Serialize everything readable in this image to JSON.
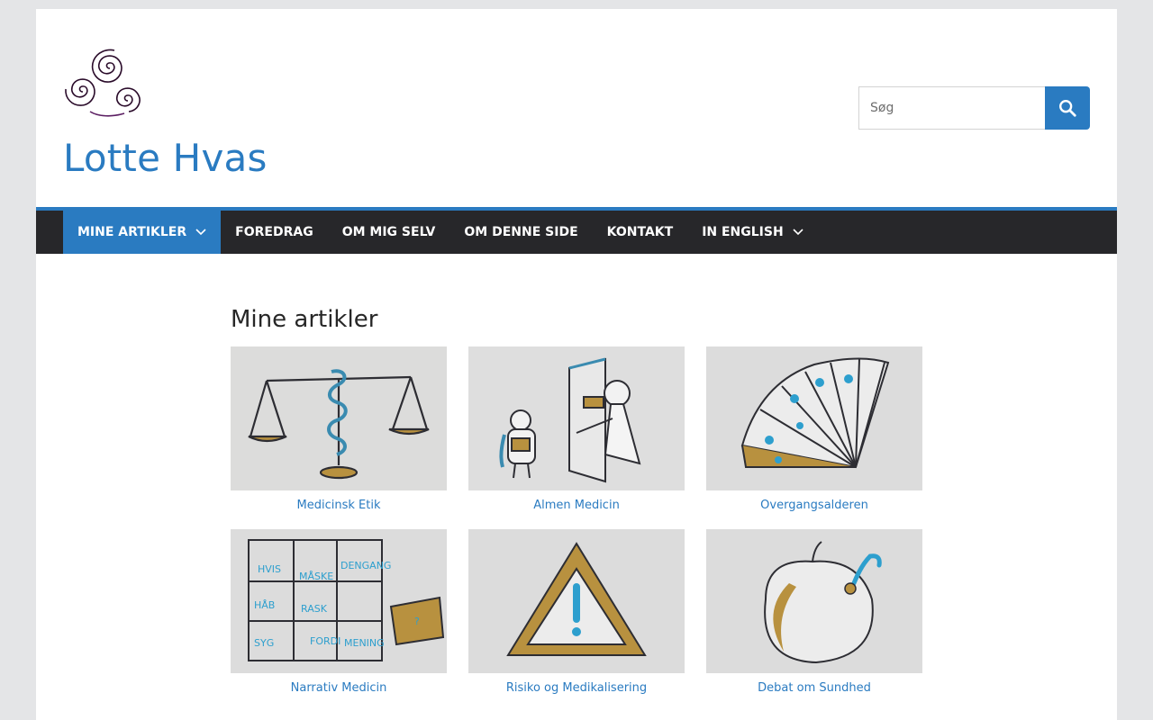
{
  "site": {
    "title": "Lotte Hvas"
  },
  "search": {
    "placeholder": "Søg"
  },
  "nav": {
    "items": [
      {
        "label": "MINE ARTIKLER",
        "has_dropdown": true,
        "active": true
      },
      {
        "label": "FOREDRAG"
      },
      {
        "label": "OM MIG SELV"
      },
      {
        "label": "OM DENNE SIDE"
      },
      {
        "label": "KONTAKT"
      },
      {
        "label": "IN ENGLISH",
        "has_dropdown": true
      }
    ]
  },
  "main": {
    "heading": "Mine artikler",
    "cards": [
      {
        "label": "Medicinsk Etik",
        "icon": "scales-serpent-drawing"
      },
      {
        "label": "Almen Medicin",
        "icon": "doctor-door-drawing"
      },
      {
        "label": "Overgangsalderen",
        "icon": "fan-drawing"
      },
      {
        "label": "Narrativ Medicin",
        "icon": "puzzle-drawing"
      },
      {
        "label": "Risiko og Medikalisering",
        "icon": "warning-triangle-drawing"
      },
      {
        "label": "Debat om Sundhed",
        "icon": "apple-worm-drawing"
      }
    ]
  },
  "colors": {
    "accent": "#2a7bc1",
    "nav_bg": "#27272a",
    "page_bg": "#e4e5e7"
  }
}
